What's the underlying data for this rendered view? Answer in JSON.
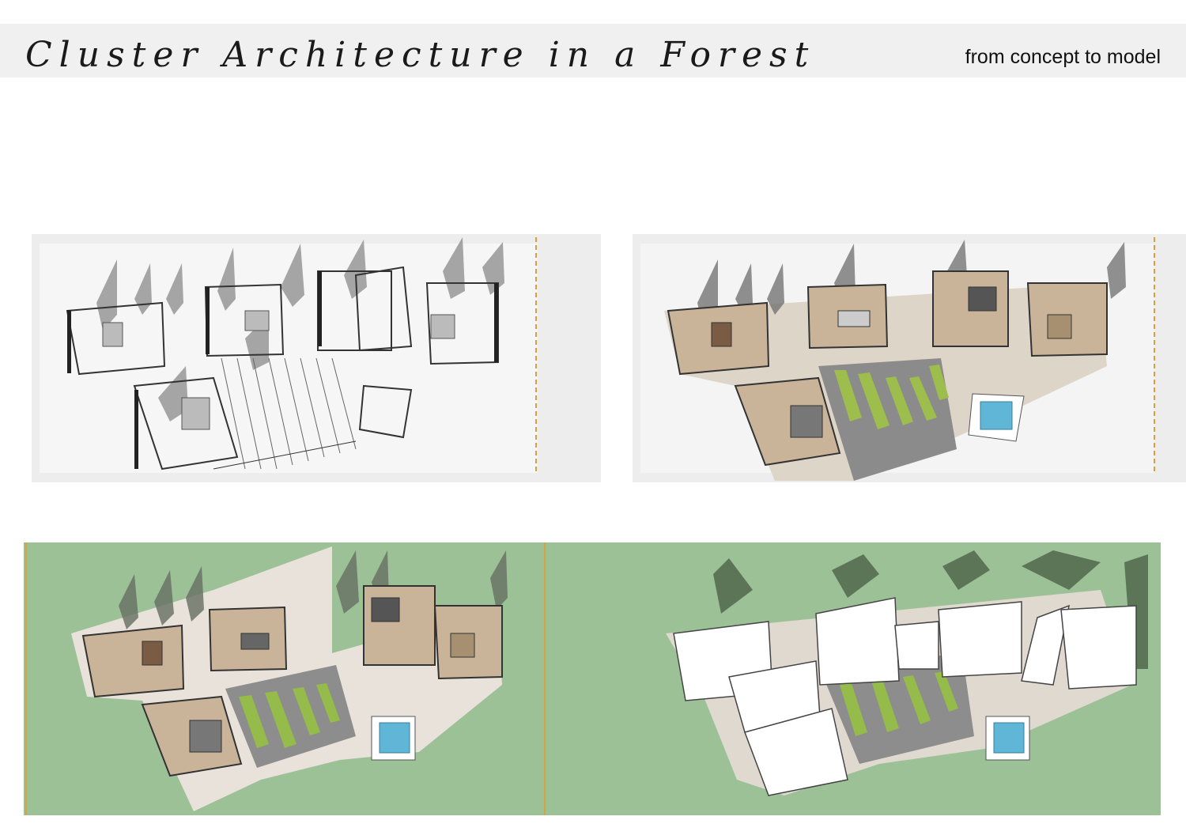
{
  "header": {
    "title": "Cluster Architecture in a Forest",
    "subtitle": "from concept to model"
  },
  "panels": [
    {
      "id": "sketch",
      "icon": "sketch-floor-plan-image"
    },
    {
      "id": "colored",
      "icon": "colored-floor-plan-image"
    },
    {
      "id": "plan-on-green",
      "icon": "floor-plan-on-grass-image"
    },
    {
      "id": "model-on-green",
      "icon": "massing-model-image"
    }
  ],
  "colors": {
    "header_band": "#f0f0f0",
    "grass": "#9cc197",
    "wood_floor": "#c9b49a",
    "shadow": "#6f6f6f",
    "pool": "#5fb6d6",
    "green_strips": "#8fb44a"
  }
}
